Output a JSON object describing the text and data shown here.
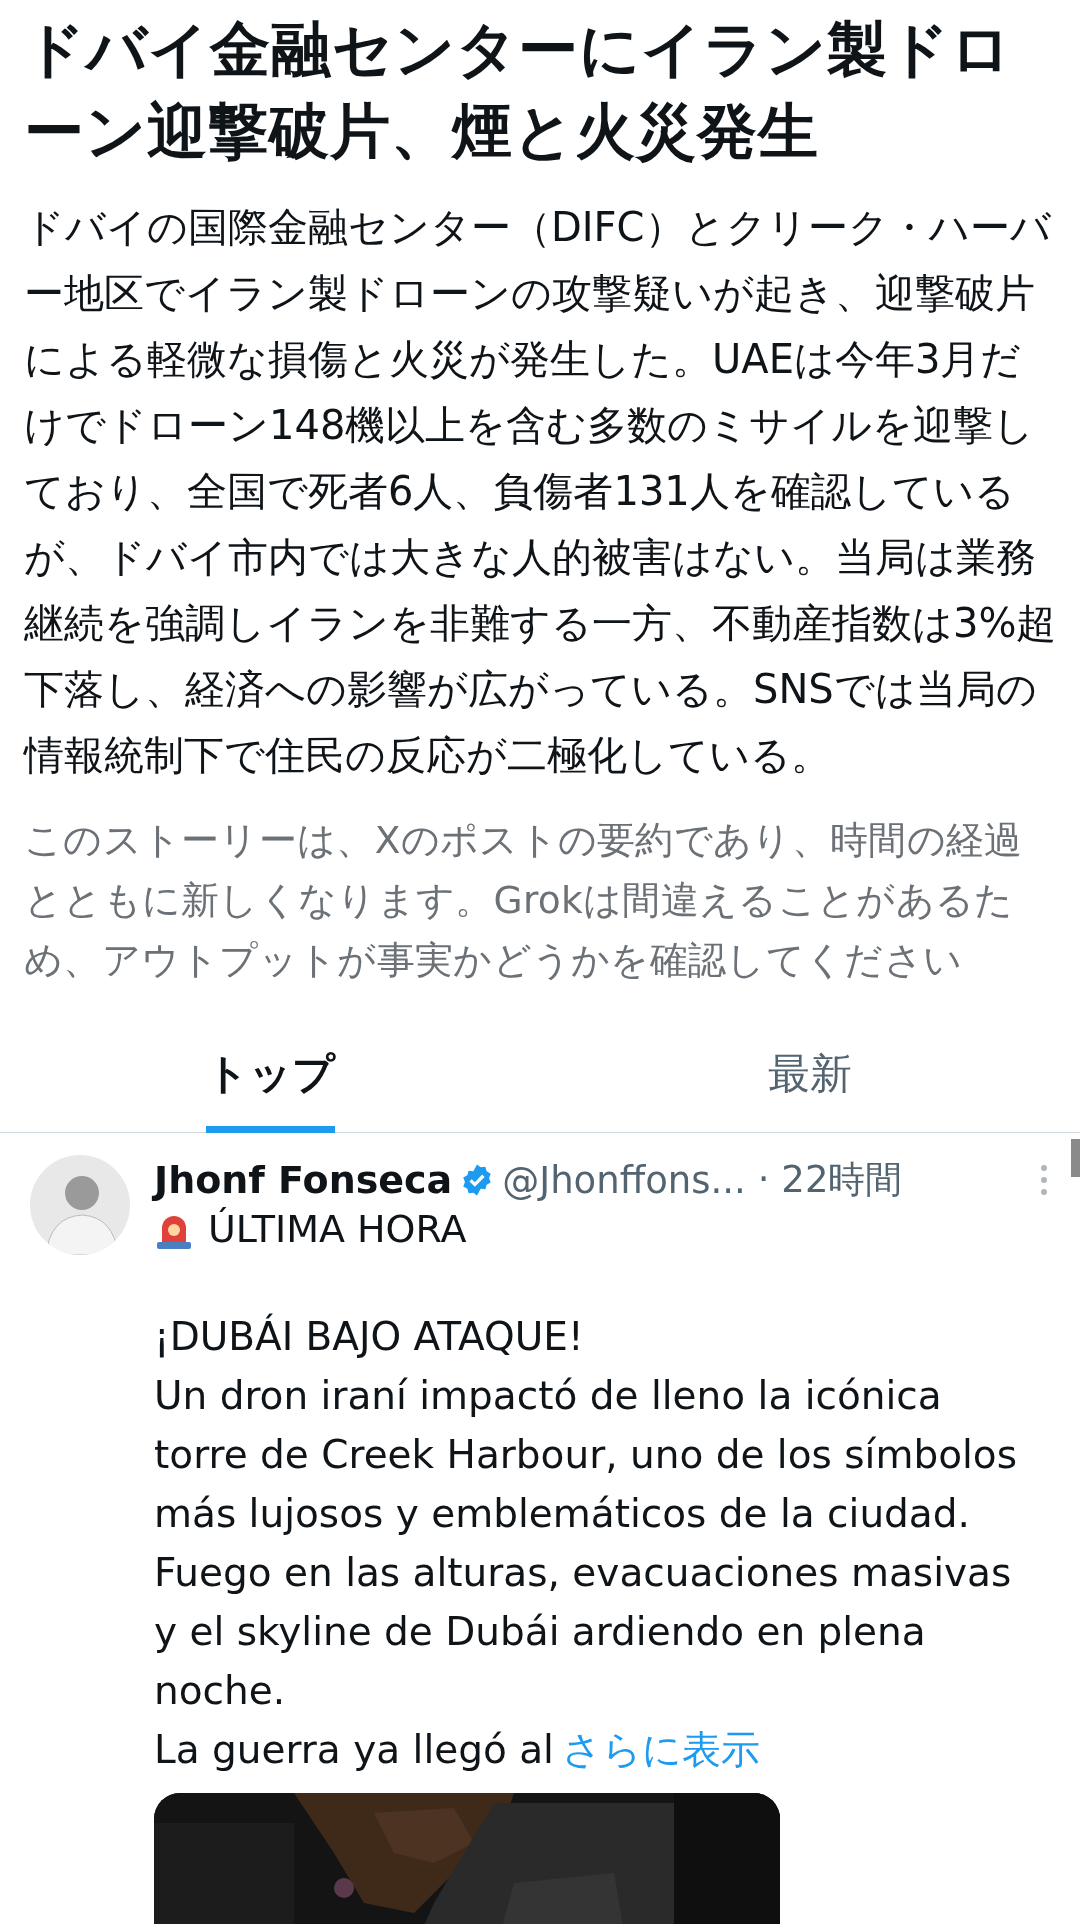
{
  "headline": "ドバイ金融センターにイラン製ドローン迎撃破片、煙と火災発生",
  "summary": "ドバイの国際金融センター（DIFC）とクリーク・ハーバー地区でイラン製ドローンの攻撃疑いが起き、迎撃破片による軽微な損傷と火災が発生した。UAEは今年3月だけでドローン148機以上を含む多数のミサイルを迎撃しており、全国で死者6人、負傷者131人を確認しているが、ドバイ市内では大きな人的被害はない。当局は業務継続を強調しイランを非難する一方、不動産指数は3%超下落し、経済への影響が広がっている。SNSでは当局の情報統制下で住民の反応が二極化している。",
  "disclaimer": "このストーリーは、Xのポストの要約であり、時間の経過とともに新しくなります。Grokは間違えることがあるため、アウトプットが事実かどうかを確認してください",
  "tabs": [
    {
      "label": "トップ",
      "selected": true
    },
    {
      "label": "最新",
      "selected": false
    }
  ],
  "post": {
    "name": "Jhonf Fonseca",
    "verified": true,
    "handle": "@Jhonffons...",
    "time": "· 22時間",
    "lead": "ÚLTIMA HORA",
    "paragraphs": [
      "¡DUBÁI BAJO ATAQUE!",
      "Un dron iraní impactó de lleno la icónica torre de Creek Harbour, uno de los símbolos más lujosos y emblemáticos de la ciudad. Fuego en las alturas, evacuaciones masivas y el skyline de Dubái ardiendo en plena noche.",
      "La guerra ya llegó al"
    ],
    "show_more": "さらに表示"
  }
}
